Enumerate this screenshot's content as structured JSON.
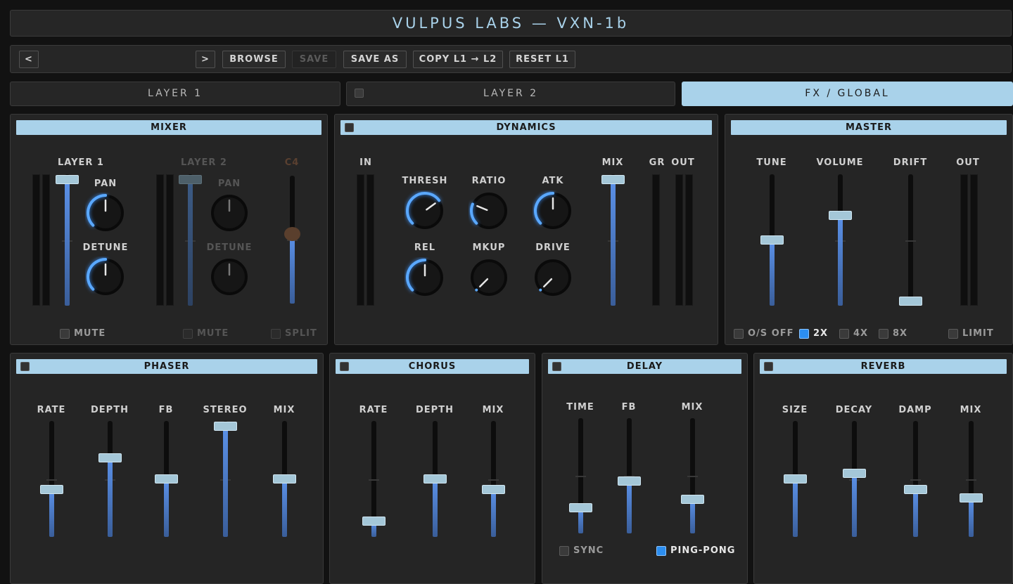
{
  "app": {
    "title": "VULPUS LABS — VXN-1b"
  },
  "toolbar": {
    "prev": "<",
    "next": ">",
    "browse": "BROWSE",
    "save": "SAVE",
    "save_as": "SAVE AS",
    "copy": "COPY L1 → L2",
    "reset": "RESET L1"
  },
  "tabs": {
    "layer1": "LAYER 1",
    "layer2": "LAYER 2",
    "fx": "FX / GLOBAL",
    "active": "FX / GLOBAL"
  },
  "mixer": {
    "title": "MIXER",
    "layer1": {
      "label": "LAYER 1",
      "level": 1.0,
      "pan_label": "PAN",
      "pan": 0.5,
      "detune_label": "DETUNE",
      "detune": 0.5,
      "mute_label": "MUTE",
      "mute": false
    },
    "layer2": {
      "label": "LAYER 2",
      "level": 1.0,
      "pan_label": "PAN",
      "pan": 0.5,
      "detune_label": "DETUNE",
      "detune": 0.5,
      "mute_label": "MUTE",
      "mute": false,
      "disabled": true
    },
    "split": {
      "label": "C4",
      "value": 0.55,
      "toggle_label": "SPLIT",
      "on": false
    }
  },
  "dynamics": {
    "title": "DYNAMICS",
    "in_label": "IN",
    "knobs": [
      {
        "label": "THRESH",
        "value": 0.7
      },
      {
        "label": "RATIO",
        "value": 0.25
      },
      {
        "label": "ATK",
        "value": 0.5
      },
      {
        "label": "REL",
        "value": 0.5
      },
      {
        "label": "MKUP",
        "value": 0.0
      },
      {
        "label": "DRIVE",
        "value": 0.0
      }
    ],
    "mix_label": "MIX",
    "mix": 1.0,
    "gr_label": "GR",
    "out_label": "OUT"
  },
  "master": {
    "title": "MASTER",
    "sliders": [
      {
        "label": "TUNE",
        "value": 0.5
      },
      {
        "label": "VOLUME",
        "value": 0.7
      },
      {
        "label": "DRIFT",
        "value": 0.0
      }
    ],
    "out_label": "OUT",
    "oversampling": [
      {
        "label": "O/S OFF",
        "on": false
      },
      {
        "label": "2X",
        "on": true
      },
      {
        "label": "4X",
        "on": false
      },
      {
        "label": "8X",
        "on": false
      }
    ],
    "limit_label": "LIMIT",
    "limit": false
  },
  "phaser": {
    "title": "PHASER",
    "sliders": [
      {
        "label": "RATE",
        "value": 0.4
      },
      {
        "label": "DEPTH",
        "value": 0.7
      },
      {
        "label": "FB",
        "value": 0.5
      },
      {
        "label": "STEREO",
        "value": 1.0
      },
      {
        "label": "MIX",
        "value": 0.5
      }
    ]
  },
  "chorus": {
    "title": "CHORUS",
    "sliders": [
      {
        "label": "RATE",
        "value": 0.1
      },
      {
        "label": "DEPTH",
        "value": 0.5
      },
      {
        "label": "MIX",
        "value": 0.4
      }
    ]
  },
  "delay": {
    "title": "DELAY",
    "sliders": [
      {
        "label": "TIME",
        "value": 0.2
      },
      {
        "label": "FB",
        "value": 0.45
      },
      {
        "label": "MIX",
        "value": 0.28
      }
    ],
    "sync_label": "SYNC",
    "sync": false,
    "pingpong_label": "PING-PONG",
    "pingpong": true
  },
  "reverb": {
    "title": "REVERB",
    "sliders": [
      {
        "label": "SIZE",
        "value": 0.5
      },
      {
        "label": "DECAY",
        "value": 0.55
      },
      {
        "label": "DAMP",
        "value": 0.4
      },
      {
        "label": "MIX",
        "value": 0.32
      }
    ]
  }
}
